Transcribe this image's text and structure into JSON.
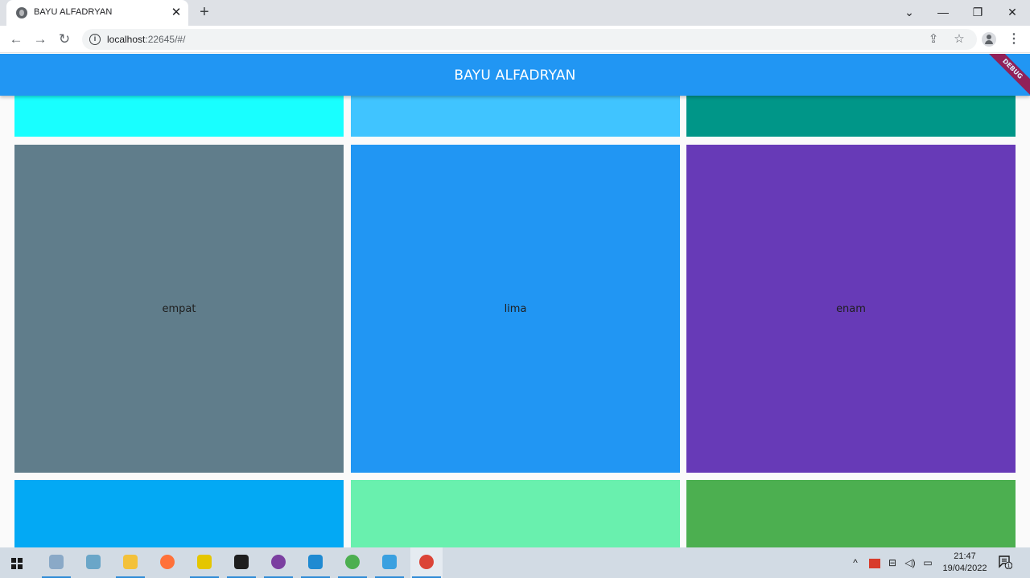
{
  "browser": {
    "tab": {
      "title": "BAYU ALFADRYAN",
      "favicon": "globe-icon",
      "close_glyph": "✕"
    },
    "new_tab_glyph": "+",
    "window_controls": {
      "tab_search": "⌄",
      "minimize": "—",
      "restore": "❐",
      "close": "✕"
    },
    "nav": {
      "back": "←",
      "forward": "→",
      "reload": "↻"
    },
    "address": {
      "host": "localhost",
      "rest": ":22645/#/",
      "info_glyph": "i"
    },
    "omnibox_icons": {
      "share": "⇪",
      "bookmark": "☆"
    },
    "menu_glyph": "⋮"
  },
  "app": {
    "title": "BAYU ALFADRYAN",
    "debug_banner": "DEBUG",
    "appbar_color": "#2196f3",
    "tiles": [
      {
        "label": "",
        "color": "#18ffff"
      },
      {
        "label": "",
        "color": "#40c4ff"
      },
      {
        "label": "",
        "color": "#009688"
      },
      {
        "label": "empat",
        "color": "#607d8b"
      },
      {
        "label": "lima",
        "color": "#2196f3"
      },
      {
        "label": "enam",
        "color": "#673ab7"
      },
      {
        "label": "",
        "color": "#03a9f4"
      },
      {
        "label": "",
        "color": "#69f0ae"
      },
      {
        "label": "",
        "color": "#4caf50"
      }
    ]
  },
  "taskbar": {
    "apps": [
      {
        "name": "settings-app-icon",
        "color": "#8aa9c7",
        "running": true
      },
      {
        "name": "file-tool-app-icon",
        "color": "#6aa6c8",
        "running": false
      },
      {
        "name": "file-explorer-icon",
        "color": "#f3c13a",
        "running": true
      },
      {
        "name": "firefox-icon",
        "color": "#ff7139",
        "running": false
      },
      {
        "name": "xampp-icon",
        "color": "#e5c600",
        "running": true
      },
      {
        "name": "terminal-icon",
        "color": "#1e1e1e",
        "running": true
      },
      {
        "name": "github-desktop-icon",
        "color": "#7b3fa0",
        "running": true
      },
      {
        "name": "vscode-icon",
        "color": "#1f8ad2",
        "running": true
      },
      {
        "name": "chrome-icon",
        "color": "#4caf50",
        "running": true
      },
      {
        "name": "control-panel-icon",
        "color": "#3aa0e0",
        "running": true
      },
      {
        "name": "chrome-active-icon",
        "color": "#db4437",
        "running": true,
        "active": true
      }
    ],
    "tray": {
      "chevron": "^",
      "network_glyph": "⊟",
      "volume_glyph": "◁)",
      "battery_glyph": "▭"
    },
    "clock": {
      "time": "21:47",
      "date": "19/04/2022"
    },
    "notification_count": "1"
  }
}
